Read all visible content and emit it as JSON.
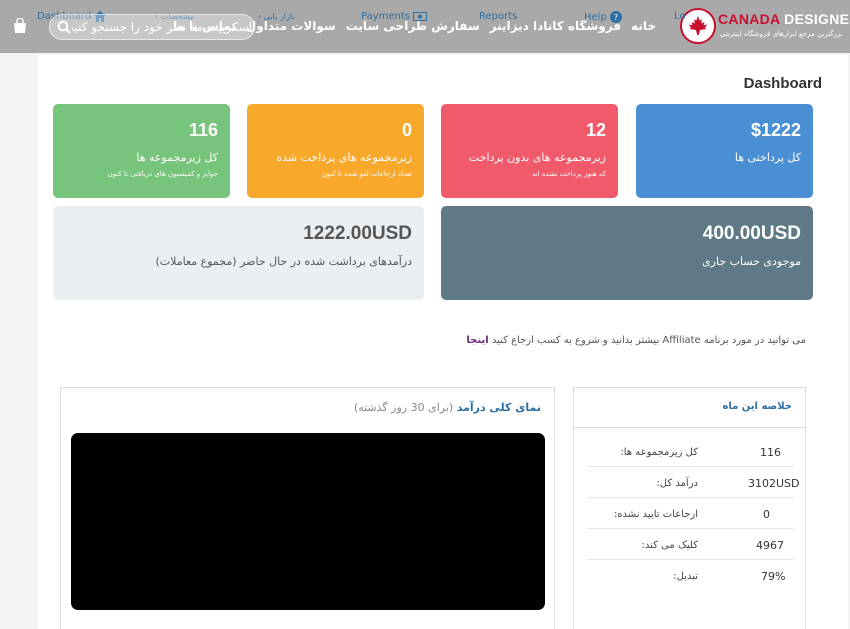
{
  "brand": {
    "name_prefix": "CANADA",
    "name_suffix": "DESIGNER",
    "tagline": "بزرگترین مرجع ابزارهای فروشگاه اینترنتی"
  },
  "nav": {
    "items": [
      "خانه",
      "فروشگاه کانادا دیزاینر",
      "سفارش طراحی سایت",
      "سوالات متداول",
      "تماس با ما"
    ]
  },
  "overlay_menu": {
    "dashboard": "Dashboard",
    "payments": "Payments",
    "reports": "Reports",
    "help": "Help",
    "lo": "Lo",
    "specs": "مشخصات",
    "market": "بازار یابی"
  },
  "search": {
    "placeholder": "اسکریپت مد نظر خود را جستجو کنید"
  },
  "page": {
    "title": "Dashboard"
  },
  "stats": [
    {
      "value": "$1222",
      "label": "کل پرداختی ها",
      "sub": "",
      "color": "#4a8fd4"
    },
    {
      "value": "12",
      "label": "زیرمجموعه های بدون پرداخت",
      "sub": "که هنوز پرداخت نشده اند",
      "color": "#f05a6a"
    },
    {
      "value": "0",
      "label": "زیرمجموعه های پرداخت شده",
      "sub": "تعداد ارجاعات لغو شده تا کنون",
      "color": "#f8a82b"
    },
    {
      "value": "116",
      "label": "کل زیرمجموعه ها",
      "sub": "جوایز و کمیسیون های دریافتی تا کنون",
      "color": "#77c47c"
    }
  ],
  "balances": {
    "current": {
      "value": "400.00USD",
      "label": "موجودی حساب جاری",
      "color": "#5f7986"
    },
    "withdrawn": {
      "value": "1222.00USD",
      "label": "درآمدهای برداشت شده در حال حاضر (مجموع معاملات)",
      "color": "#eaeff3"
    }
  },
  "affiliate": {
    "text": "می توانید در مورد برنامه Affiliate بیشتر بدانید و شروع به کسب ارجاع کنید",
    "link": "اینجا"
  },
  "summary": {
    "title": "خلاصه این ماه",
    "rows": [
      {
        "label": "کل زیرمجموعه ها:",
        "value": "116"
      },
      {
        "label": "درآمد کل:",
        "value": "3102USD"
      },
      {
        "label": "ارجاعات تایید نشده:",
        "value": "0"
      },
      {
        "label": "کلیک می کند:",
        "value": "4967"
      },
      {
        "label": "تبدیل:",
        "value": "79%"
      }
    ]
  },
  "earnings_chart": {
    "title": "نمای کلی درآمد",
    "period": "(برای 30 روز گذشته)"
  },
  "icons": [
    "flag-logo-icon",
    "search-icon",
    "cart-icon",
    "home-icon",
    "money-icon",
    "help-icon",
    "chevron-icon"
  ]
}
